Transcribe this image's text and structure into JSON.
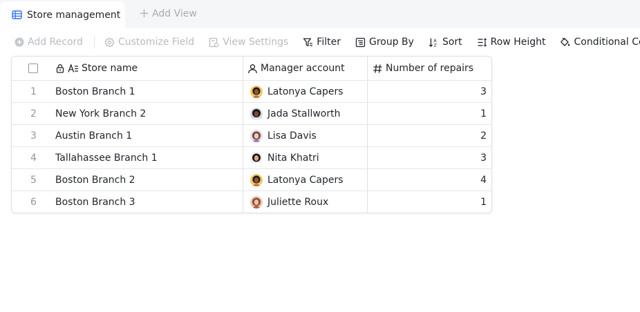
{
  "tabs": {
    "active_label": "Store management",
    "add_view_label": "Add View"
  },
  "toolbar": {
    "add_record": "Add Record",
    "customize_field": "Customize Field",
    "view_settings": "View Settings",
    "filter": "Filter",
    "group_by": "Group By",
    "sort": "Sort",
    "row_height": "Row Height",
    "conditional_coloring": "Conditional Coloring"
  },
  "table": {
    "columns": {
      "store_name": "Store name",
      "manager_account": "Manager account",
      "number_of_repairs": "Number of repairs"
    },
    "rows": [
      {
        "index": "1",
        "store": "Boston Branch 1",
        "manager": "Latonya Capers",
        "repairs": "3",
        "avatar": "avatar-latonya"
      },
      {
        "index": "2",
        "store": "New York Branch 2",
        "manager": "Jada Stallworth",
        "repairs": "1",
        "avatar": "avatar-jada"
      },
      {
        "index": "3",
        "store": "Austin Branch 1",
        "manager": "Lisa Davis",
        "repairs": "2",
        "avatar": "avatar-lisa"
      },
      {
        "index": "4",
        "store": "Tallahassee Branch 1",
        "manager": "Nita Khatri",
        "repairs": "3",
        "avatar": "avatar-nita"
      },
      {
        "index": "5",
        "store": "Boston Branch 2",
        "manager": "Latonya Capers",
        "repairs": "4",
        "avatar": "avatar-latonya"
      },
      {
        "index": "6",
        "store": "Boston Branch 3",
        "manager": "Juliette Roux",
        "repairs": "1",
        "avatar": "avatar-juliette"
      }
    ]
  },
  "colors": {
    "accent": "#3370ff",
    "border": "#dee0e3",
    "muted_text": "#8f959e",
    "disabled_text": "#b8bbc2",
    "tabbar_bg": "#f5f6f7"
  }
}
